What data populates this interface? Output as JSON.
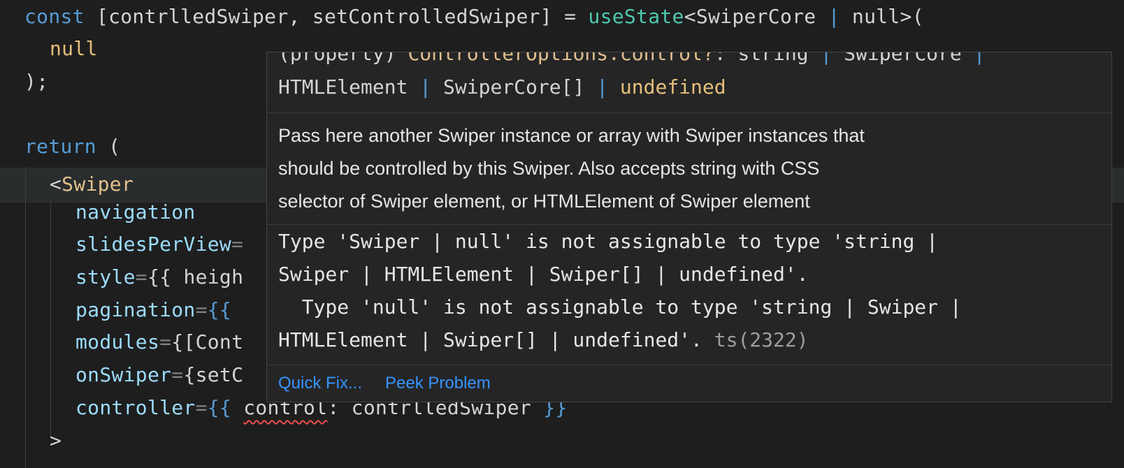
{
  "colors": {
    "editor_bg": "#1e1e1e",
    "keyword": "#569cd6",
    "function": "#4ec9b0",
    "tag": "#e2c08d",
    "attribute": "#9cdcfe",
    "null": "#e5c07b",
    "error_squiggle": "#f14c4c",
    "link": "#3794ff",
    "hover_bg": "#252526"
  },
  "code": {
    "line1": {
      "kw": "const",
      "destructure": " [contrlledSwiper, setControlledSwiper] = ",
      "fn": "useState",
      "generic_open": "<SwiperCore ",
      "pipe": "|",
      "generic_close": " null>("
    },
    "line2": {
      "value": "null"
    },
    "line3": {
      "text": ");"
    },
    "line5": {
      "kw": "return",
      "rest": " ("
    },
    "line6": {
      "open": "<",
      "tag": "Swiper"
    },
    "line7": {
      "attr": "navigation"
    },
    "line8": {
      "attr": "slidesPerView",
      "eq": "="
    },
    "line9": {
      "attr": "style",
      "eq": "=",
      "rest": "{{ heigh"
    },
    "line10": {
      "attr": "pagination",
      "eq": "=",
      "rest": "{{"
    },
    "line11": {
      "attr": "modules",
      "eq": "=",
      "rest": "{[Cont"
    },
    "line12": {
      "attr": "onSwiper",
      "eq": "=",
      "rest": "{setC"
    },
    "line13": {
      "attr": "controller",
      "eq": "=",
      "open": "{{ ",
      "prop": "control",
      "colon": ": contrlledSwiper ",
      "close": "}}"
    },
    "line14": {
      "text": ">"
    }
  },
  "hover": {
    "signature": {
      "line0_a": "(property) ",
      "line0_b": "ControllerOptions.control?",
      "line0_c": ": string ",
      "line0_pipe1": "|",
      "line0_d": " SwiperCore ",
      "line0_pipe2": "|",
      "line1_a": "HTMLElement ",
      "line1_pipe1": "|",
      "line1_b": " SwiperCore[] ",
      "line1_pipe2": "|",
      "line1_c": " undefined"
    },
    "documentation": [
      "Pass here another Swiper instance or array with Swiper instances that",
      "should be controlled by this Swiper. Also accepts string with CSS",
      "selector of Swiper element, or HTMLElement of Swiper element"
    ],
    "problem": [
      "Type 'Swiper | null' is not assignable to type 'string |",
      "Swiper | HTMLElement | Swiper[] | undefined'.",
      "  Type 'null' is not assignable to type 'string | Swiper |",
      "HTMLElement | Swiper[] | undefined'. "
    ],
    "problem_code": "ts(2322)",
    "actions": {
      "quick_fix": "Quick Fix...",
      "peek_problem": "Peek Problem"
    }
  }
}
